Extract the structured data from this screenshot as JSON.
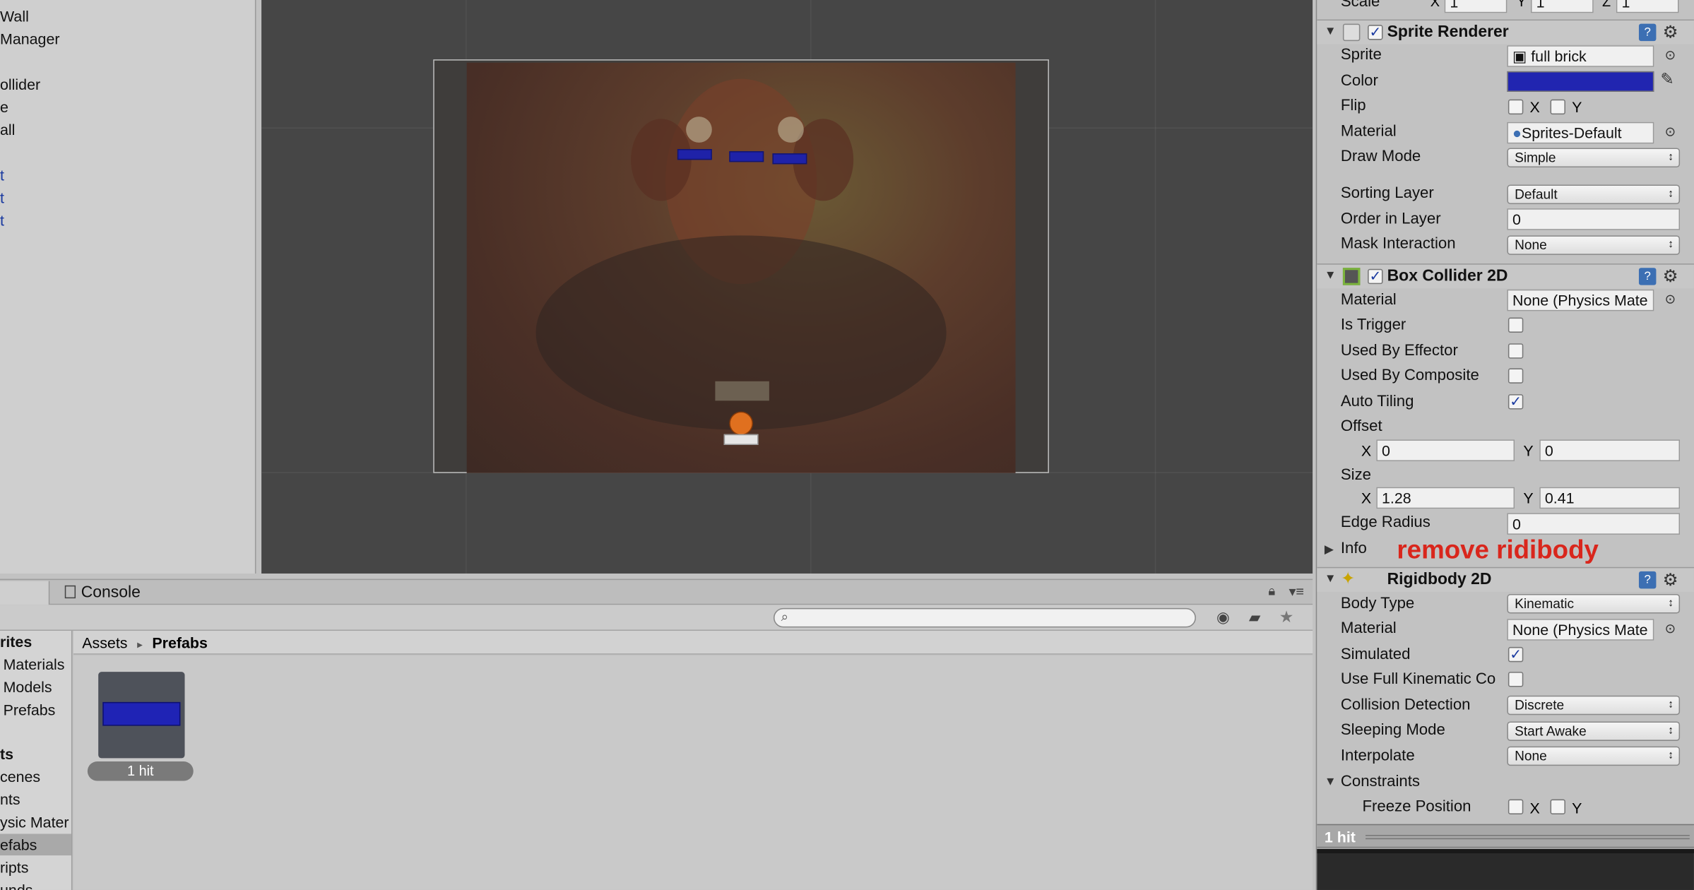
{
  "hierarchy": {
    "items": [
      {
        "label": "Wall",
        "blue": false
      },
      {
        "label": "Manager",
        "blue": false
      },
      {
        "label": "ollider",
        "blue": false
      },
      {
        "label": "e",
        "blue": false
      },
      {
        "label": "all",
        "blue": false
      },
      {
        "label": "t",
        "blue": true
      },
      {
        "label": "t",
        "blue": true
      },
      {
        "label": "t",
        "blue": true
      }
    ]
  },
  "bottom_panel": {
    "console_tab": "Console",
    "breadcrumb": {
      "root": "Assets",
      "separator": "▸",
      "current": "Prefabs"
    },
    "project_tree": [
      "rites",
      "Materials",
      "Models",
      "Prefabs",
      "ts",
      "cenes",
      "nts",
      "ysic Mater",
      "efabs",
      "ripts",
      "unds"
    ],
    "asset": {
      "label": "1 hit"
    }
  },
  "inspector": {
    "transform": {
      "label": "Scale",
      "x_label": "X",
      "x": "1",
      "y_label": "Y",
      "y": "1",
      "z_label": "Z",
      "z": "1"
    },
    "sprite_renderer": {
      "title": "Sprite Renderer",
      "sprite_label": "Sprite",
      "sprite_value": "full brick",
      "color_label": "Color",
      "color_value": "#2125b0",
      "flip_label": "Flip",
      "flip_x": "X",
      "flip_y": "Y",
      "material_label": "Material",
      "material_value": "Sprites-Default",
      "draw_mode_label": "Draw Mode",
      "draw_mode_value": "Simple",
      "sorting_layer_label": "Sorting Layer",
      "sorting_layer_value": "Default",
      "order_label": "Order in Layer",
      "order_value": "0",
      "mask_label": "Mask Interaction",
      "mask_value": "None"
    },
    "box_collider": {
      "title": "Box Collider 2D",
      "material_label": "Material",
      "material_value": "None (Physics Mate",
      "is_trigger_label": "Is Trigger",
      "used_by_effector_label": "Used By Effector",
      "used_by_composite_label": "Used By Composite",
      "auto_tiling_label": "Auto Tiling",
      "offset_label": "Offset",
      "offset_x_label": "X",
      "offset_x": "0",
      "offset_y_label": "Y",
      "offset_y": "0",
      "size_label": "Size",
      "size_x_label": "X",
      "size_x": "1.28",
      "size_y_label": "Y",
      "size_y": "0.41",
      "edge_radius_label": "Edge Radius",
      "edge_radius_value": "0",
      "info_label": "Info"
    },
    "annotation": "remove ridibody",
    "rigidbody": {
      "title": "Rigidbody 2D",
      "body_type_label": "Body Type",
      "body_type_value": "Kinematic",
      "material_label": "Material",
      "material_value": "None (Physics Mate",
      "simulated_label": "Simulated",
      "full_kinematic_label": "Use Full Kinematic Co",
      "collision_label": "Collision Detection",
      "collision_value": "Discrete",
      "sleeping_label": "Sleeping Mode",
      "sleeping_value": "Start Awake",
      "interpolate_label": "Interpolate",
      "interpolate_value": "None",
      "constraints_label": "Constraints",
      "freeze_label": "Freeze Position",
      "freeze_x": "X",
      "freeze_y": "Y"
    },
    "preview_title": "1 hit"
  }
}
